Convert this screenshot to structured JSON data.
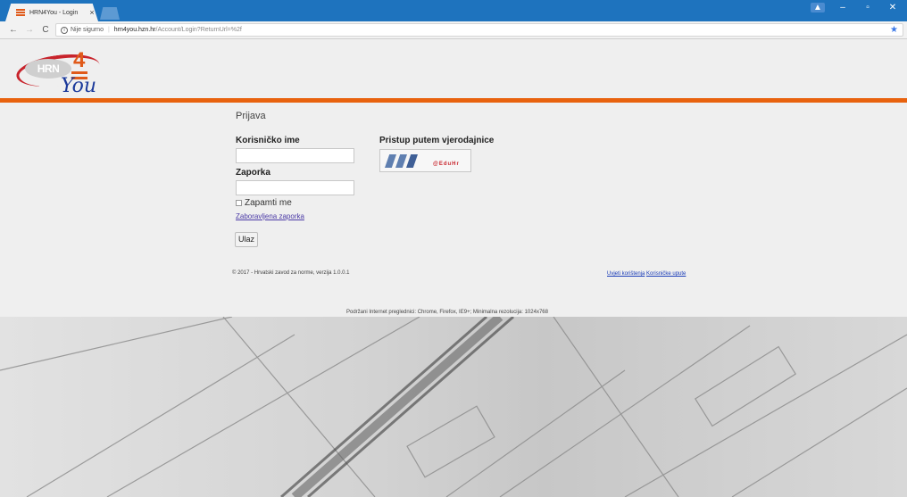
{
  "browser": {
    "tab_title": "HRN4You - Login",
    "tab_close": "×",
    "insecure_label": "Nije sigurno",
    "url_host": "hrn4you.hzn.hr",
    "url_path": "/Account/Login?ReturnUrl=%2f",
    "back": "←",
    "forward": "→",
    "reload": "C",
    "info_glyph": "i",
    "separator": "|",
    "star": "★",
    "user_badge": "▲",
    "minimize": "–",
    "maximize": "▫",
    "close": "✕"
  },
  "logo": {
    "hrn": "HRN",
    "four": "4",
    "you": "You"
  },
  "login": {
    "title": "Prijava",
    "username_label": "Korisničko ime",
    "password_label": "Zaporka",
    "username_value": "",
    "password_value": "",
    "remember_label": "Zapamti me",
    "forgot_link": "Zaboravljena zaporka",
    "submit_label": "Ulaz"
  },
  "federated": {
    "heading": "Pristup putem vjerodajnice",
    "provider_text": "@EduHr"
  },
  "footer": {
    "copyright": "© 2017 - Hrvatski zavod za norme, verzija 1.0.0.1",
    "terms_link": "Uvjeti korištenja",
    "manual_link": "Korisničke upute",
    "support_text": "Podržani Internet preglednici: Chrome, Firefox, IE9+; Minimalna rezolucija: 1024x768"
  },
  "colors": {
    "accent_orange": "#e8620e",
    "titlebar_blue": "#1e73be",
    "link_blue": "#1a3cb8"
  }
}
